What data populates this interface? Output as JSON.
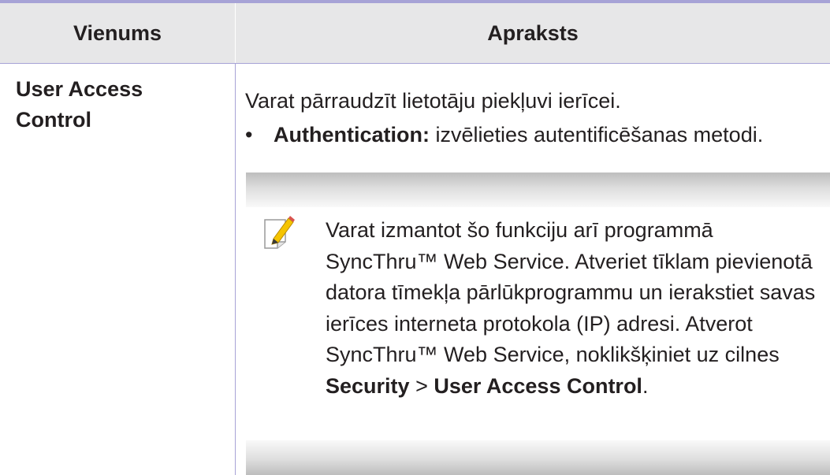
{
  "table": {
    "headers": {
      "item": "Vienums",
      "description": "Apraksts"
    },
    "row": {
      "item_name": "User Access Control",
      "intro": "Varat pārraudzīt lietotāju piekļuvi ierīcei.",
      "bullet": {
        "marker": "•",
        "label": "Authentication:",
        "text": " izvēlieties autentificēšanas metodi."
      },
      "note": {
        "icon": "note-pencil-icon",
        "text_before": "Varat izmantot šo funkciju arī programmā SyncThru™ Web Service. Atveriet tīklam pievienotā datora tīmekļa pārlūkprogrammu un ierakstiet savas ierīces interneta protokola (IP) adresi. Atverot SyncThru™ Web Service, noklikšķiniet uz cilnes ",
        "security_label": "Security",
        "separator": " > ",
        "uac_label": "User Access Control",
        "end": "."
      }
    }
  },
  "colors": {
    "header_background": "#e7e7e8",
    "rule": "#a7a3d6",
    "text": "#231f20",
    "icon_accent": "#f5c400"
  }
}
